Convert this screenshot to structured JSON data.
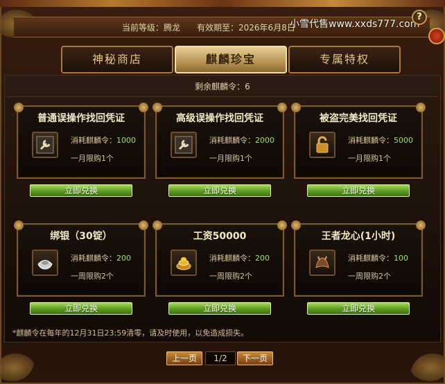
{
  "header": {
    "level_label": "当前等级：",
    "level_value": "腾龙",
    "expiry_label": "有效期至：",
    "expiry_value": "2026年6月8日",
    "watermark": "小雪代售www.xxds777.com",
    "help_symbol": "?"
  },
  "tabs": [
    {
      "label": "神秘商店",
      "active": false
    },
    {
      "label": "麒麟珍宝",
      "active": true
    },
    {
      "label": "专属特权",
      "active": false
    }
  ],
  "remaining": "剩余麒麟令：6",
  "cost_prefix": "消耗麒麟令：",
  "items": [
    {
      "title": "普通误操作找回凭证",
      "cost": "1000",
      "limit": "一月限购1个",
      "button": "立即兑换",
      "icon": "wrench-icon",
      "color": "#9a8a70"
    },
    {
      "title": "高级误操作找回凭证",
      "cost": "2000",
      "limit": "一月限购1个",
      "button": "立即兑换",
      "icon": "wrench-icon",
      "color": "#9a8a70"
    },
    {
      "title": "被盗完美找回凭证",
      "cost": "5000",
      "limit": "一月限购1个",
      "button": "立即兑换",
      "icon": "lock-icon",
      "color": "#c9902a"
    },
    {
      "title": "绑银（30锭）",
      "cost": "200",
      "limit": "一周限购2个",
      "button": "立即兑换",
      "icon": "silver-ingot-icon",
      "color": "#c8c8c8"
    },
    {
      "title": "工资50000",
      "cost": "200",
      "limit": "一周限购2个",
      "button": "立即兑换",
      "icon": "gold-coins-icon",
      "color": "#e0b030"
    },
    {
      "title": "王者龙心(1小时)",
      "cost": "100",
      "limit": "一周限购2个",
      "button": "立即兑换",
      "icon": "dragon-heart-icon",
      "color": "#8a5a3a"
    }
  ],
  "note": "*麒麟令在每年的12月31日23:59清零，请及时使用，以免造成损失。",
  "pager": {
    "prev": "上一页",
    "page": "1/2",
    "next": "下一页"
  }
}
